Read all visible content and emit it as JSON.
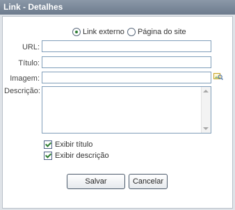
{
  "dialog": {
    "title": "Link - Detalhes"
  },
  "link_type": {
    "options": [
      {
        "label": "Link externo",
        "selected": true
      },
      {
        "label": "Página do site",
        "selected": false
      }
    ]
  },
  "form": {
    "url": {
      "label": "URL:",
      "value": ""
    },
    "titulo": {
      "label": "Título:",
      "value": ""
    },
    "imagem": {
      "label": "Imagem:",
      "value": "",
      "browse_icon": "image-browse-icon"
    },
    "descricao": {
      "label": "Descrição:",
      "value": ""
    }
  },
  "options": {
    "exibir_titulo": {
      "label": "Exibir título",
      "checked": true
    },
    "exibir_descricao": {
      "label": "Exibir descrição",
      "checked": true
    }
  },
  "buttons": {
    "save": "Salvar",
    "cancel": "Cancelar"
  },
  "colors": {
    "titlebar": "#7b8898",
    "accent_check": "#2e7d32",
    "input_border": "#7f9db9"
  }
}
